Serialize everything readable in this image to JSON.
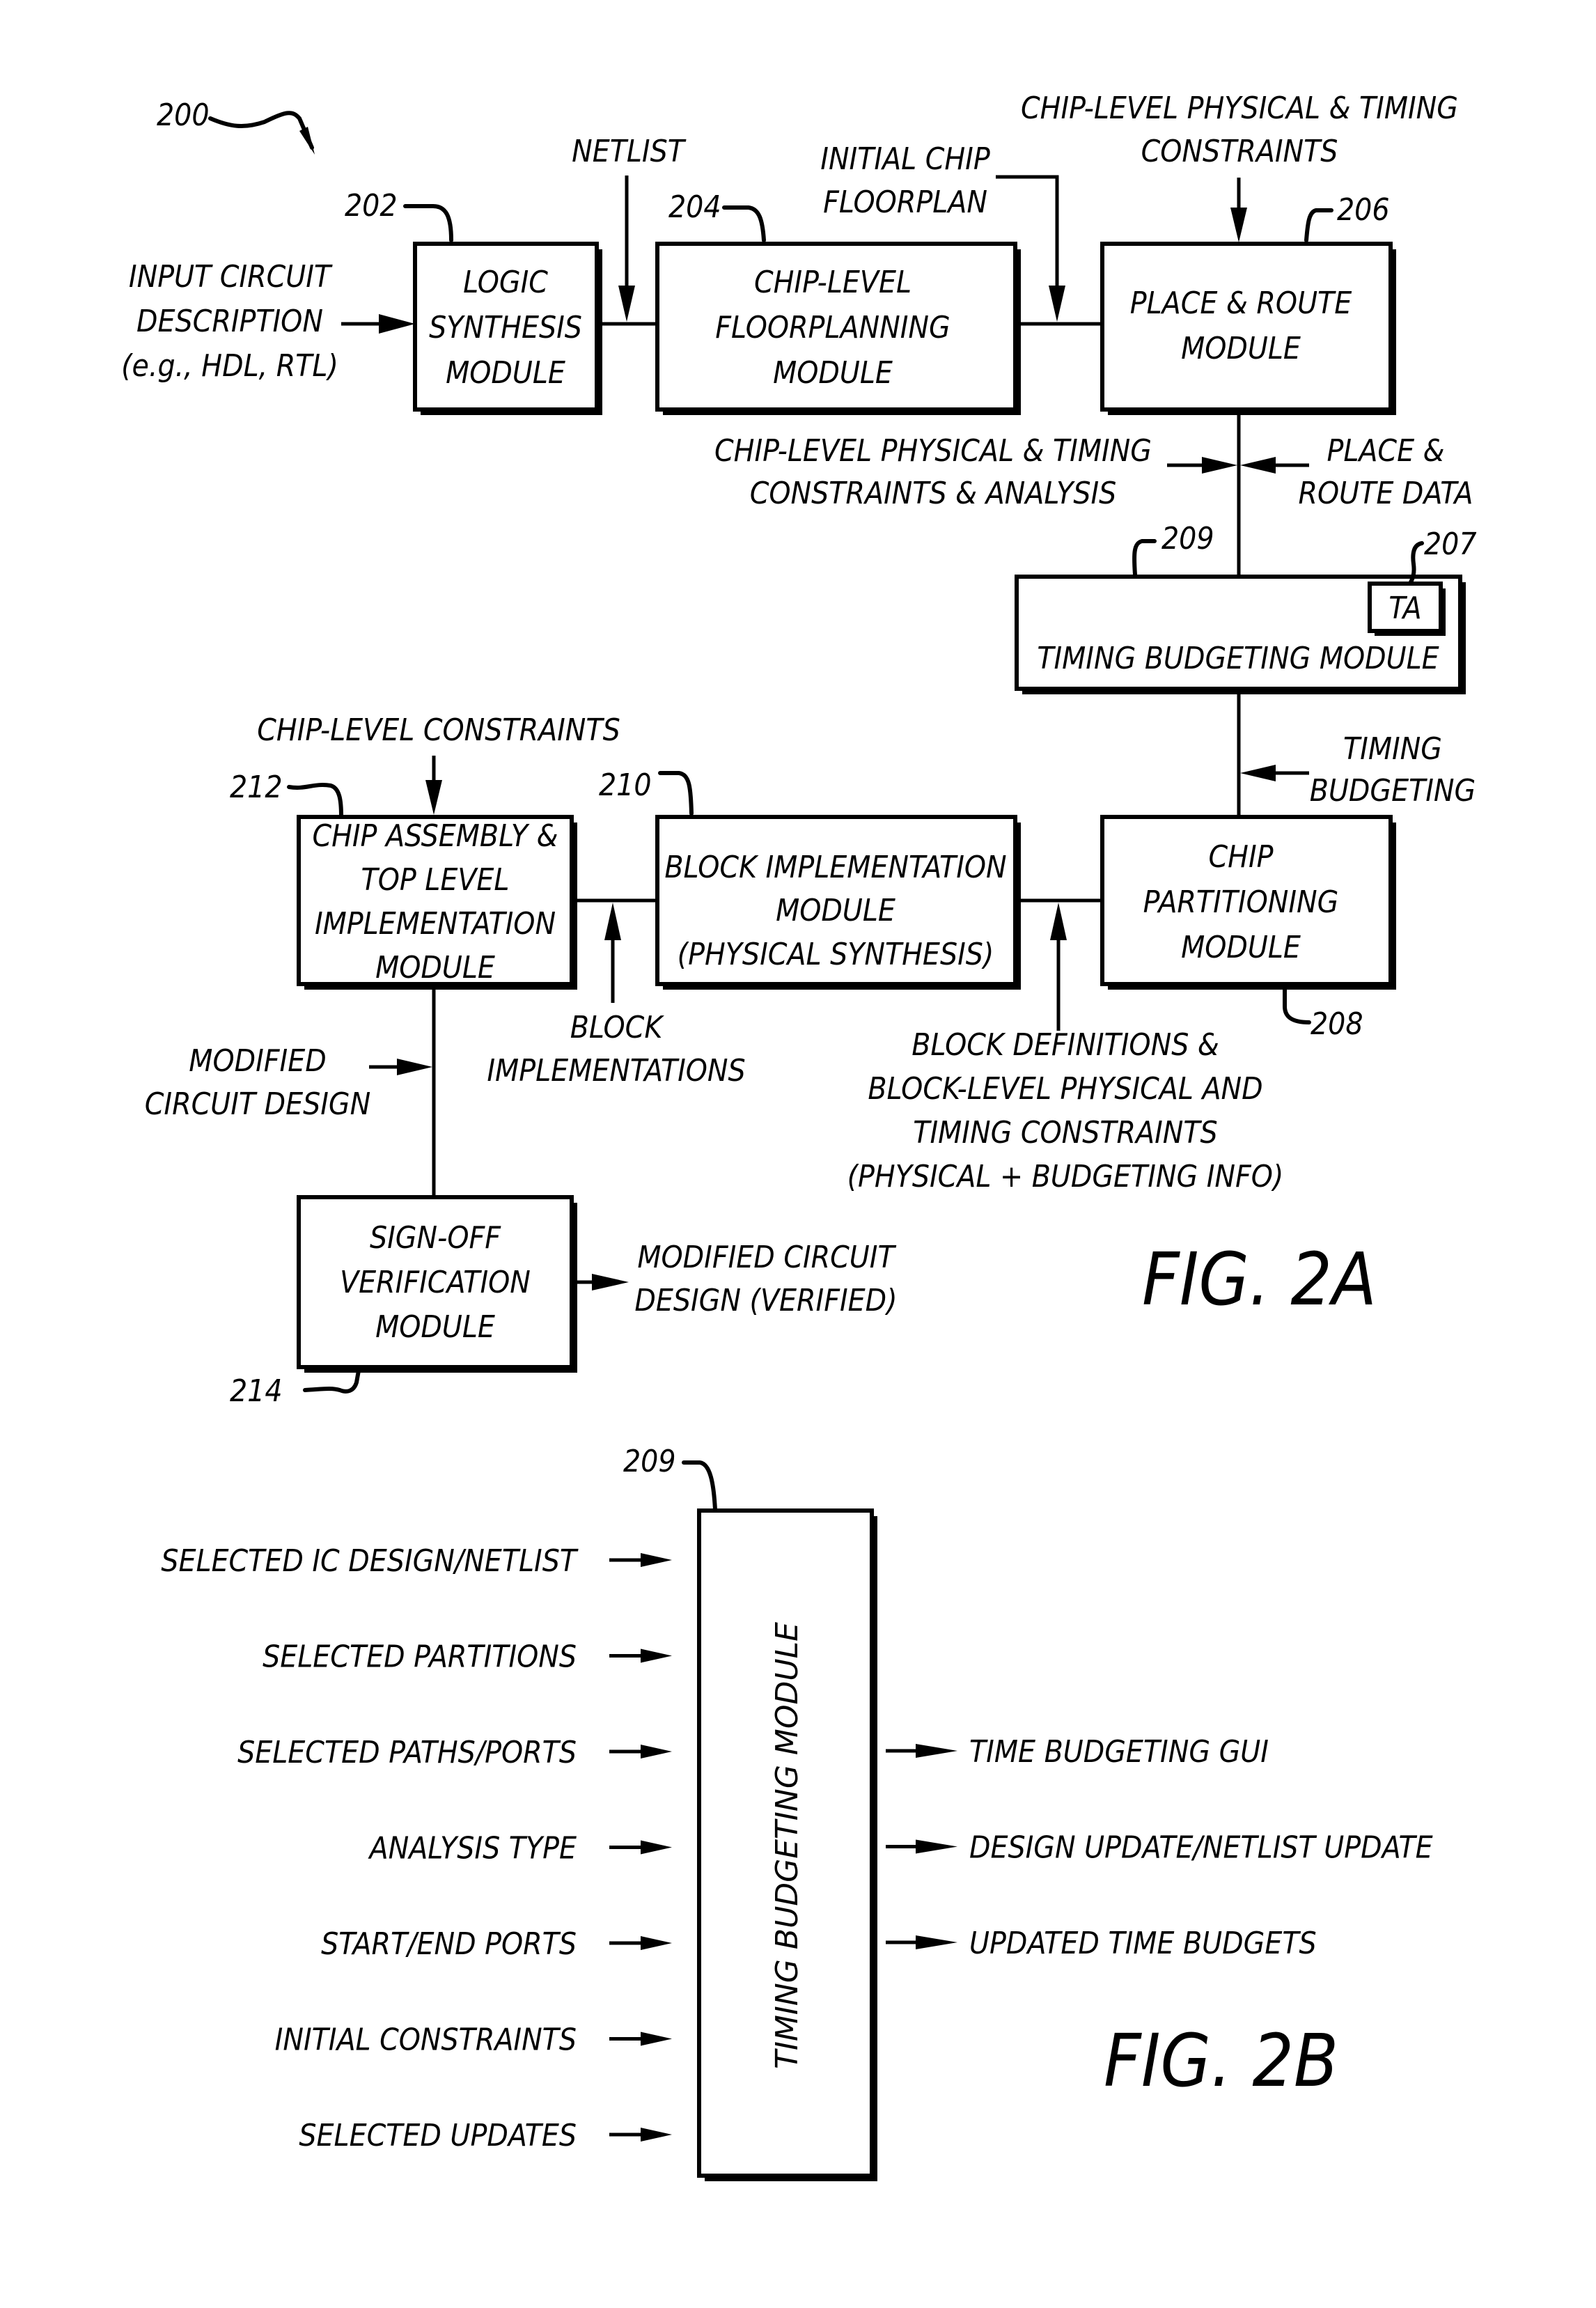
{
  "figure_2a": {
    "ref_main": "200",
    "caption": "FIG. 2A",
    "modules": {
      "logic_synthesis": {
        "ref": "202",
        "lines": [
          "LOGIC",
          "SYNTHESIS",
          "MODULE"
        ]
      },
      "floorplanning": {
        "ref": "204",
        "lines": [
          "CHIP-LEVEL",
          "FLOORPLANNING",
          "MODULE"
        ]
      },
      "place_route": {
        "ref": "206",
        "lines": [
          "PLACE & ROUTE",
          "MODULE"
        ]
      },
      "timing_budgeting": {
        "ref": "209",
        "lines": [
          "TIMING BUDGETING MODULE"
        ],
        "sub_ref": "207",
        "sub_label": "TA"
      },
      "chip_partitioning": {
        "ref": "208",
        "lines": [
          "CHIP",
          "PARTITIONING",
          "MODULE"
        ]
      },
      "block_implementation": {
        "ref": "210",
        "lines": [
          "BLOCK IMPLEMENTATION",
          "MODULE",
          "(PHYSICAL SYNTHESIS)"
        ]
      },
      "chip_assembly": {
        "ref": "212",
        "lines": [
          "CHIP ASSEMBLY &",
          "TOP LEVEL",
          "IMPLEMENTATION",
          "MODULE"
        ]
      },
      "signoff_verification": {
        "ref": "214",
        "lines": [
          "SIGN-OFF",
          "VERIFICATION",
          "MODULE"
        ]
      }
    },
    "signals": {
      "input_circuit": [
        "INPUT CIRCUIT",
        "DESCRIPTION",
        "(e.g., HDL, RTL)"
      ],
      "netlist": [
        "NETLIST"
      ],
      "initial_floorplan": [
        "INITIAL CHIP",
        "FLOORPLAN"
      ],
      "chip_constraints_top": [
        "CHIP-LEVEL PHYSICAL & TIMING",
        "CONSTRAINTS"
      ],
      "chip_constraints_analysis": [
        "CHIP-LEVEL PHYSICAL & TIMING",
        "CONSTRAINTS & ANALYSIS"
      ],
      "place_route_data": [
        "PLACE &",
        "ROUTE DATA"
      ],
      "timing_budgeting": [
        "TIMING",
        "BUDGETING"
      ],
      "chip_level_constraints": [
        "CHIP-LEVEL CONSTRAINTS"
      ],
      "block_implementations": [
        "BLOCK",
        "IMPLEMENTATIONS"
      ],
      "block_definitions": [
        "BLOCK DEFINITIONS &",
        "BLOCK-LEVEL PHYSICAL AND",
        "TIMING CONSTRAINTS",
        "(PHYSICAL + BUDGETING INFO)"
      ],
      "modified_design": [
        "MODIFIED",
        "CIRCUIT DESIGN"
      ],
      "verified_design": [
        "MODIFIED CIRCUIT",
        "DESIGN (VERIFIED)"
      ]
    }
  },
  "figure_2b": {
    "caption": "FIG. 2B",
    "module_ref": "209",
    "module_label": "TIMING BUDGETING MODULE",
    "inputs": [
      "SELECTED IC DESIGN/NETLIST",
      "SELECTED PARTITIONS",
      "SELECTED PATHS/PORTS",
      "ANALYSIS TYPE",
      "START/END PORTS",
      "INITIAL CONSTRAINTS",
      "SELECTED UPDATES"
    ],
    "outputs": [
      "TIME BUDGETING GUI",
      "DESIGN UPDATE/NETLIST UPDATE",
      "UPDATED TIME BUDGETS"
    ]
  }
}
